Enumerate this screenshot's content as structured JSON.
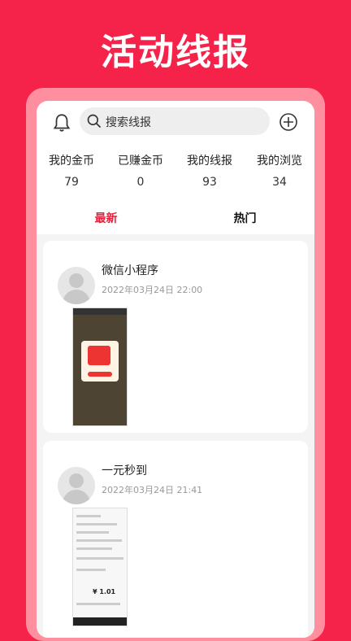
{
  "banner": {
    "title": "活动线报"
  },
  "topbar": {
    "bell_icon": "bell-icon",
    "search_placeholder": "搜索线报",
    "plus_icon": "plus-circle-icon"
  },
  "stats": [
    {
      "label": "我的金币",
      "value": "79"
    },
    {
      "label": "已赚金币",
      "value": "0"
    },
    {
      "label": "我的线报",
      "value": "93"
    },
    {
      "label": "我的浏览",
      "value": "34"
    }
  ],
  "tabs": [
    {
      "label": "最新",
      "active": true
    },
    {
      "label": "热门",
      "active": false
    }
  ],
  "feed": [
    {
      "title": "微信小程序",
      "time": "2022年03月24日 22:00",
      "amount": ""
    },
    {
      "title": "一元秒到",
      "time": "2022年03月24日 21:41",
      "amount": "¥ 1.01"
    }
  ],
  "colors": {
    "brand": "#f5234a",
    "active_tab": "#e8213f"
  }
}
